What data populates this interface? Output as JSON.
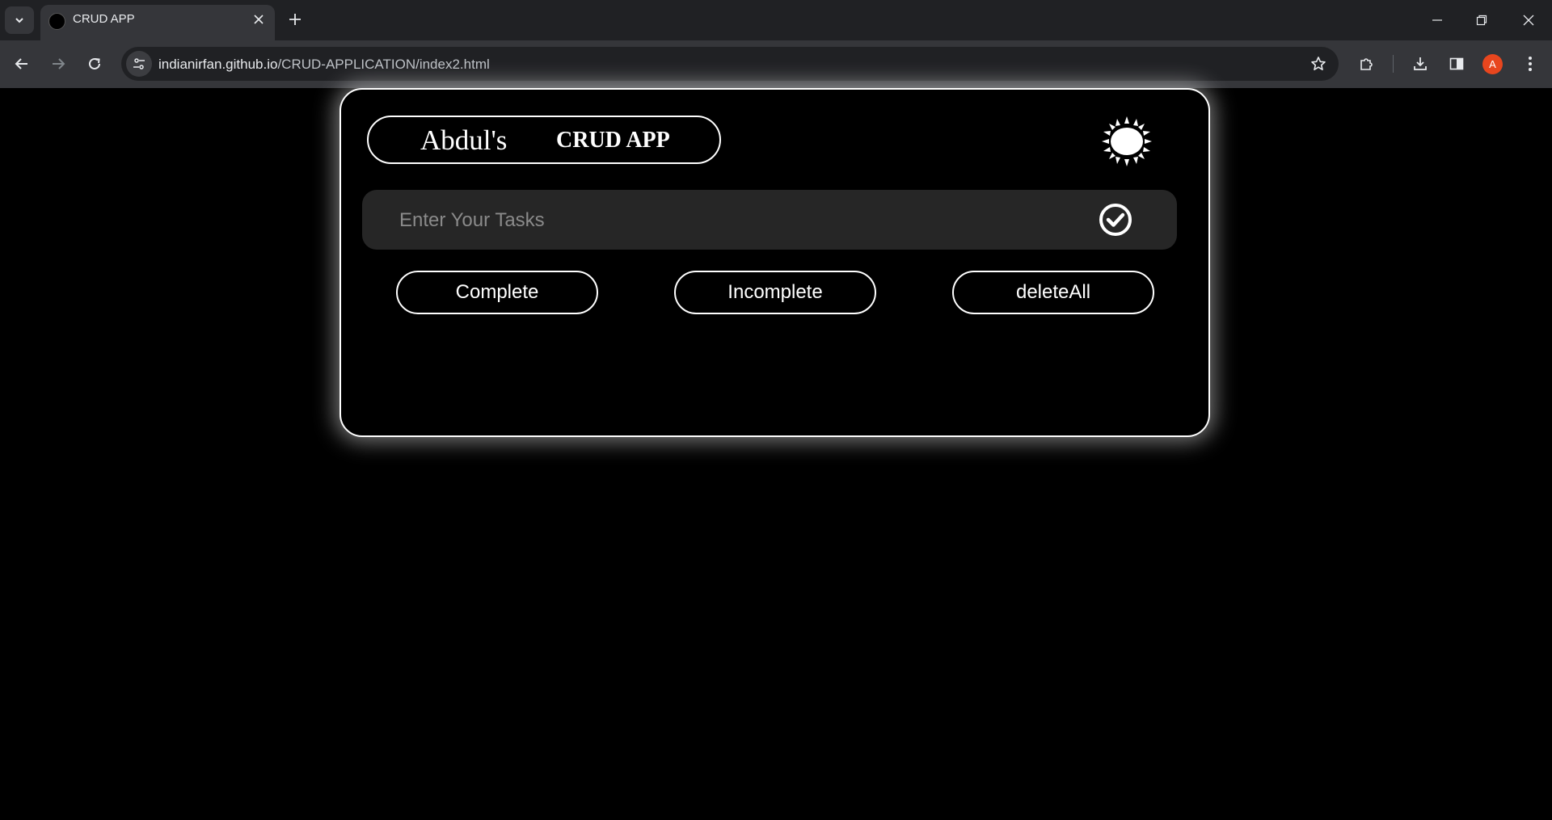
{
  "browser": {
    "tab_title": "CRUD APP",
    "url_host": "indianirfan.github.io",
    "url_path": "/CRUD-APPLICATION/index2.html",
    "profile_initial": "A"
  },
  "app": {
    "logo_name": "Abdul's",
    "logo_app": "CRUD APP",
    "task_placeholder": "Enter Your Tasks",
    "buttons": {
      "complete": "Complete",
      "incomplete": "Incomplete",
      "delete_all": "deleteAll"
    }
  },
  "icons": {
    "theme_toggle": "sun-icon",
    "add_task": "check-circle-icon"
  },
  "colors": {
    "page_bg": "#000000",
    "accent": "#ffffff",
    "input_bg": "#262626"
  }
}
